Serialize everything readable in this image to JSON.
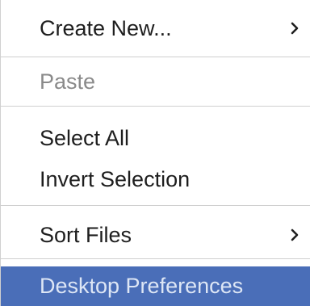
{
  "menu": {
    "items": [
      {
        "label": "Create New...",
        "submenu": true,
        "enabled": true
      },
      {
        "label": "Paste",
        "submenu": false,
        "enabled": false
      },
      {
        "label": "Select All",
        "submenu": false,
        "enabled": true
      },
      {
        "label": "Invert Selection",
        "submenu": false,
        "enabled": true
      },
      {
        "label": "Sort Files",
        "submenu": true,
        "enabled": true
      },
      {
        "label": "Desktop Preferences",
        "submenu": false,
        "enabled": true,
        "highlighted": true
      }
    ]
  },
  "icons": {
    "submenu_arrow": "chevron-right-icon"
  },
  "colors": {
    "background": "#ffffff",
    "text": "#1e1e1e",
    "disabled_text": "#8a8a8a",
    "highlight_background": "#4a6eb8",
    "highlight_text": "#dde6f5",
    "separator": "#cfcfcf"
  }
}
